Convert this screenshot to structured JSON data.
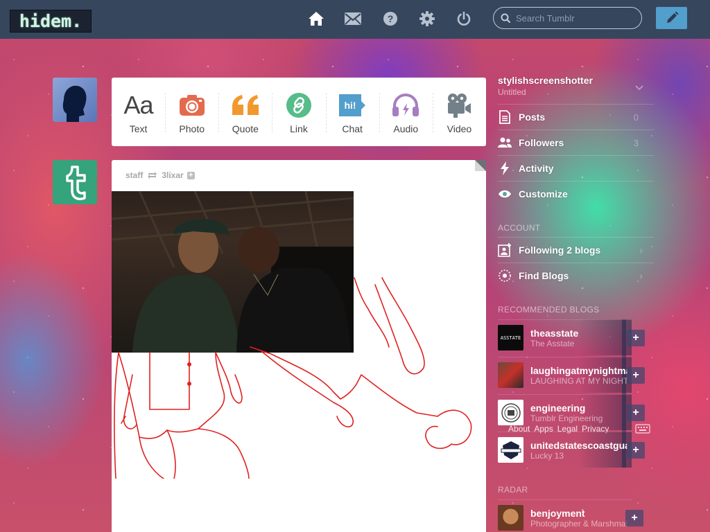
{
  "header": {
    "logo": "hidem.",
    "search_placeholder": "Search Tumblr"
  },
  "post_types": [
    {
      "label": "Text",
      "icon": "text-icon"
    },
    {
      "label": "Photo",
      "icon": "camera-icon"
    },
    {
      "label": "Quote",
      "icon": "quote-icon"
    },
    {
      "label": "Link",
      "icon": "link-icon"
    },
    {
      "label": "Chat",
      "icon": "chat-icon"
    },
    {
      "label": "Audio",
      "icon": "headphones-icon"
    },
    {
      "label": "Video",
      "icon": "video-camera-icon"
    }
  ],
  "post": {
    "author": "staff",
    "reblogged_from": "3lixar",
    "plus": "+"
  },
  "sidebar": {
    "blog_title": "stylishscreenshotter",
    "blog_subtitle": "Untitled",
    "items": [
      {
        "label": "Posts",
        "count": "0"
      },
      {
        "label": "Followers",
        "count": "3"
      },
      {
        "label": "Activity"
      },
      {
        "label": "Customize"
      }
    ],
    "account_heading": "ACCOUNT",
    "account_items": [
      {
        "label": "Following 2 blogs"
      },
      {
        "label": "Find Blogs"
      }
    ],
    "recommended_heading": "RECOMMENDED BLOGS",
    "recommended": [
      {
        "name": "theasstate",
        "subtitle": "The Asstate",
        "avatar_text": "ASSTATE"
      },
      {
        "name": "laughingatmynightmares",
        "subtitle": "LAUGHING AT MY NIGHTMARES"
      },
      {
        "name": "engineering",
        "subtitle": "Tumblr Engineering"
      },
      {
        "name": "unitedstatescoastguard",
        "subtitle": "Lucky 13"
      }
    ],
    "follow_label": "+",
    "footer_links": [
      "About",
      "Apps",
      "Legal",
      "Privacy"
    ],
    "radar_heading": "RADAR",
    "radar": {
      "name": "benjoyment",
      "subtitle": "Photographer & Marshmallow"
    }
  },
  "colors": {
    "header_bg": "#36465d",
    "accent": "#529ecc",
    "photo_icon": "#e46a4e",
    "quote_icon": "#f2992e",
    "link_icon": "#56bc8a",
    "chat_icon": "#529ecc",
    "audio_icon": "#a77dc2",
    "video_icon": "#748089"
  }
}
